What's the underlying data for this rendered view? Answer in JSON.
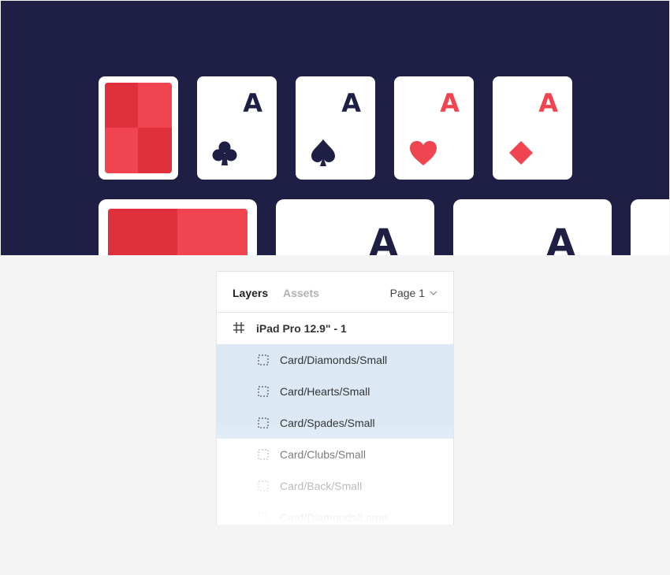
{
  "canvas": {
    "background": "#1f1f45",
    "cards_small": [
      {
        "kind": "back"
      },
      {
        "kind": "face",
        "rank": "A",
        "suit": "clubs",
        "color": "#1f1f45"
      },
      {
        "kind": "face",
        "rank": "A",
        "suit": "spades",
        "color": "#1f1f45"
      },
      {
        "kind": "face",
        "rank": "A",
        "suit": "hearts",
        "color": "#f04450"
      },
      {
        "kind": "face",
        "rank": "A",
        "suit": "diamonds",
        "color": "#f04450"
      }
    ],
    "cards_large": [
      {
        "kind": "back"
      },
      {
        "kind": "face",
        "rank": "A",
        "color": "#1f1f45"
      },
      {
        "kind": "face",
        "rank": "A",
        "color": "#1f1f45"
      },
      {
        "kind": "face",
        "rank": "",
        "color": "#1f1f45"
      }
    ],
    "card_colors": {
      "face": "#ffffff",
      "back_light": "#f04450",
      "back_dark": "#e0303c"
    }
  },
  "layers_panel": {
    "tabs": [
      {
        "label": "Layers",
        "active": true
      },
      {
        "label": "Assets",
        "active": false
      }
    ],
    "page_selector": {
      "label": "Page 1",
      "icon": "chevron-down-icon"
    },
    "frame": {
      "icon": "hash-frame-icon",
      "label": "iPad Pro 12.9\" - 1"
    },
    "layers": [
      {
        "label": "Card/Diamonds/Small",
        "icon": "component-instance-icon",
        "selected": true
      },
      {
        "label": "Card/Hearts/Small",
        "icon": "component-instance-icon",
        "selected": true
      },
      {
        "label": "Card/Spades/Small",
        "icon": "component-instance-icon",
        "selected": true
      },
      {
        "label": "Card/Clubs/Small",
        "icon": "component-instance-icon",
        "selected": false
      },
      {
        "label": "Card/Back/Small",
        "icon": "component-instance-icon",
        "selected": false
      },
      {
        "label": "Card/Diamonds/Large",
        "icon": "component-instance-icon",
        "selected": false
      }
    ],
    "selection_color": "#dce9f5"
  }
}
